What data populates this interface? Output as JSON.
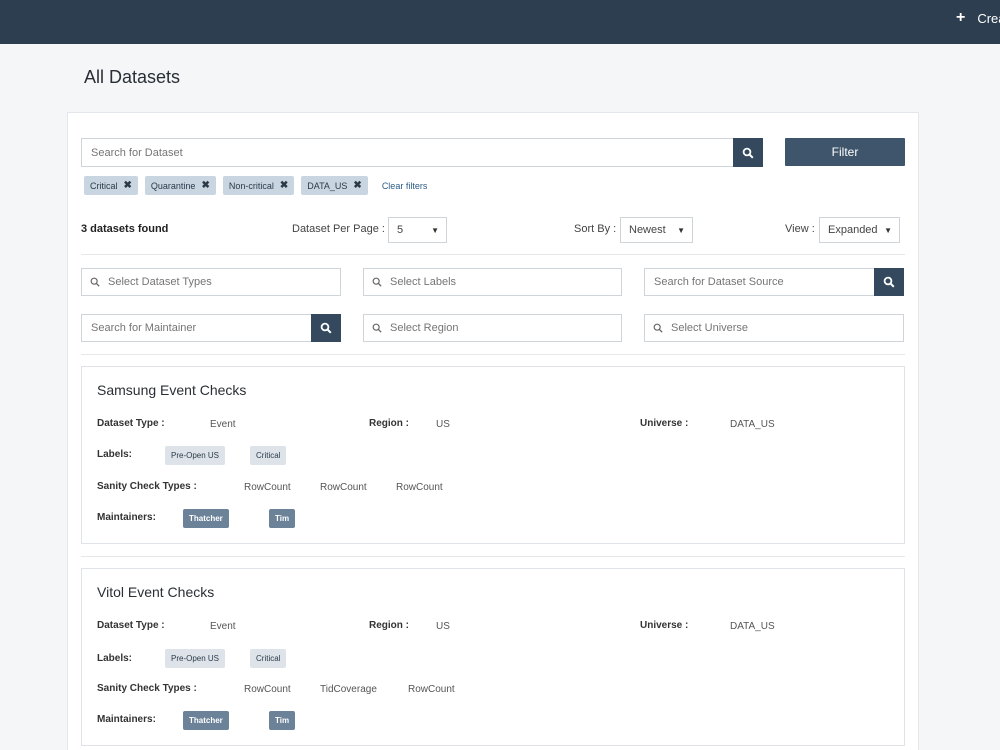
{
  "header": {
    "create_label": "Crea",
    "plus_icon": "+"
  },
  "page": {
    "title": "All Datasets"
  },
  "search": {
    "placeholder": "Search for Dataset",
    "filter_label": "Filter"
  },
  "active_filters": [
    "Critical",
    "Quarantine",
    "Non-critical",
    "DATA_US"
  ],
  "clear_filters_label": "Clear filters",
  "results": {
    "found_text": "3 datasets found",
    "per_page_label": "Dataset Per Page :",
    "per_page_value": "5",
    "sort_label": "Sort By :",
    "sort_value": "Newest",
    "view_label": "View :",
    "view_value": "Expanded"
  },
  "filters": {
    "dataset_types": "Select Dataset Types",
    "labels": "Select Labels",
    "dataset_source": "Search for Dataset Source",
    "maintainer": "Search for Maintainer",
    "region": "Select Region",
    "universe": "Select Universe"
  },
  "field_labels": {
    "dataset_type": "Dataset Type :",
    "region": "Region :",
    "universe": "Universe :",
    "labels": "Labels:",
    "sanity_check_types": "Sanity Check Types :",
    "maintainers": "Maintainers:"
  },
  "datasets": [
    {
      "title": "Samsung Event Checks",
      "dataset_type": "Event",
      "region": "US",
      "universe": "DATA_US",
      "labels": [
        "Pre-Open US",
        "Critical"
      ],
      "sanity_checks": [
        "RowCount",
        "RowCount",
        "RowCount"
      ],
      "maintainers": [
        "Thatcher",
        "Tim"
      ]
    },
    {
      "title": "Vitol Event Checks",
      "dataset_type": "Event",
      "region": "US",
      "universe": "DATA_US",
      "labels": [
        "Pre-Open US",
        "Critical"
      ],
      "sanity_checks": [
        "RowCount",
        "TidCoverage",
        "RowCount"
      ],
      "maintainers": [
        "Thatcher",
        "Tim"
      ]
    }
  ],
  "colors": {
    "topbar": "#2c3e4f",
    "button": "#34495e",
    "chip": "#c9d6e2",
    "maintainer_tag": "#6b8299"
  }
}
